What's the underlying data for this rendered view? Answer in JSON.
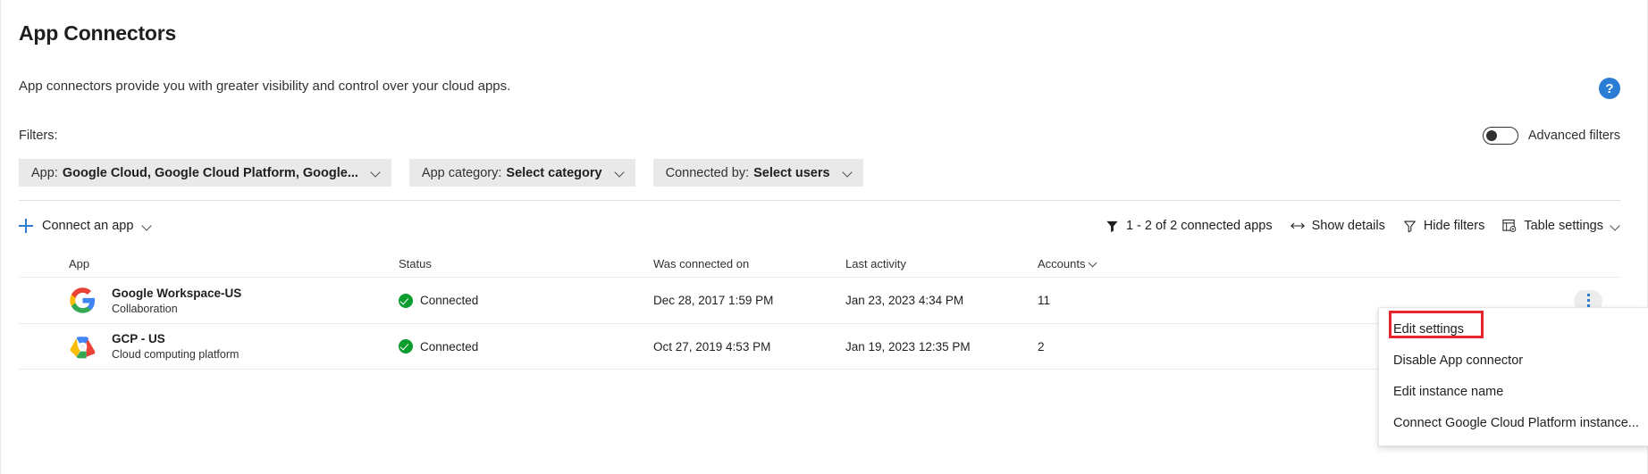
{
  "header": {
    "title": "App Connectors",
    "subtitle": "App connectors provide you with greater visibility and control over your cloud apps.",
    "help_icon_label": "?"
  },
  "filters": {
    "label": "Filters:",
    "advanced_filters_label": "Advanced filters",
    "advanced_filters_on": false,
    "pills": [
      {
        "prefix": "App:",
        "value": "Google Cloud, Google Cloud Platform, Google..."
      },
      {
        "prefix": "App category:",
        "value": "Select category"
      },
      {
        "prefix": "Connected by:",
        "value": "Select users"
      }
    ]
  },
  "command_bar": {
    "connect_app_label": "Connect an app",
    "count_label": "1 - 2 of 2 connected apps",
    "show_details_label": "Show details",
    "hide_filters_label": "Hide filters",
    "table_settings_label": "Table settings"
  },
  "table": {
    "columns": [
      "App",
      "Status",
      "Was connected on",
      "Last activity",
      "Accounts"
    ],
    "rows": [
      {
        "app_name": "Google Workspace-US",
        "app_category": "Collaboration",
        "logo": "google-g-logo",
        "status": "Connected",
        "connected_on": "Dec 28, 2017 1:59 PM",
        "last_activity": "Jan 23, 2023 4:34 PM",
        "accounts": "11"
      },
      {
        "app_name": "GCP - US",
        "app_category": "Cloud computing platform",
        "logo": "google-cloud-platform-logo",
        "status": "Connected",
        "connected_on": "Oct 27, 2019 4:53 PM",
        "last_activity": "Jan 19, 2023 12:35 PM",
        "accounts": "2"
      }
    ]
  },
  "context_menu": {
    "items": [
      "Edit settings",
      "Disable App connector",
      "Edit instance name",
      "Connect Google Cloud Platform instance..."
    ],
    "highlighted_index": 0,
    "highlight_color": "#e8242c"
  },
  "colors": {
    "accent_blue": "#2b7cd3",
    "status_green": "#0b9d2e",
    "pill_gray": "#e9e9e9",
    "border_gray": "#e1dfdd"
  }
}
